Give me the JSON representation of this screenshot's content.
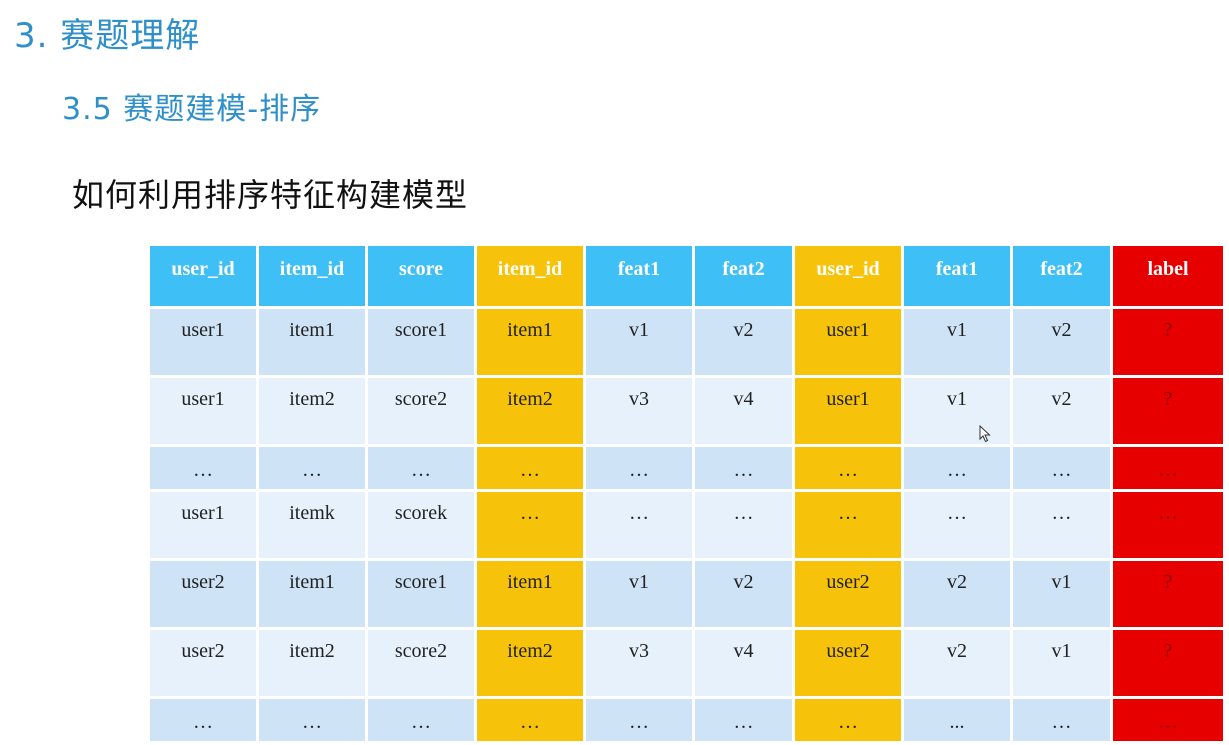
{
  "section_title": "3. 赛题理解",
  "subsection_title": "3.5 赛题建模-排序",
  "question": "如何利用排序特征构建模型",
  "table": {
    "headers": [
      "user_id",
      "item_id",
      "score",
      "item_id",
      "feat1",
      "feat2",
      "user_id",
      "feat1",
      "feat2",
      "label"
    ],
    "rows": [
      [
        "user1",
        "item1",
        "score1",
        "item1",
        "v1",
        "v2",
        "user1",
        "v1",
        "v2",
        "?"
      ],
      [
        "user1",
        "item2",
        "score2",
        "item2",
        "v3",
        "v4",
        "user1",
        "v1",
        "v2",
        "?"
      ],
      [
        "…",
        "…",
        "…",
        "…",
        "…",
        "…",
        "…",
        "…",
        "…",
        "…"
      ],
      [
        "user1",
        "itemk",
        "scorek",
        "…",
        "…",
        "…",
        "…",
        "…",
        "…",
        "…"
      ],
      [
        "user2",
        "item1",
        "score1",
        "item1",
        "v1",
        "v2",
        "user2",
        "v2",
        "v1",
        "?"
      ],
      [
        "user2",
        "item2",
        "score2",
        "item2",
        "v3",
        "v4",
        "user2",
        "v2",
        "v1",
        "?"
      ],
      [
        "…",
        "…",
        "…",
        "…",
        "…",
        "…",
        "…",
        "...",
        "…",
        "…"
      ]
    ]
  },
  "colors": {
    "header_blue": "#3ebff5",
    "highlight_yellow": "#f7c30a",
    "label_red": "#e60000",
    "row_blue_dark": "#cfe3f7",
    "row_blue_light": "#e6f1fb",
    "title_blue": "#2e8fc9"
  },
  "icons": {
    "cursor": "mouse-pointer-icon"
  }
}
